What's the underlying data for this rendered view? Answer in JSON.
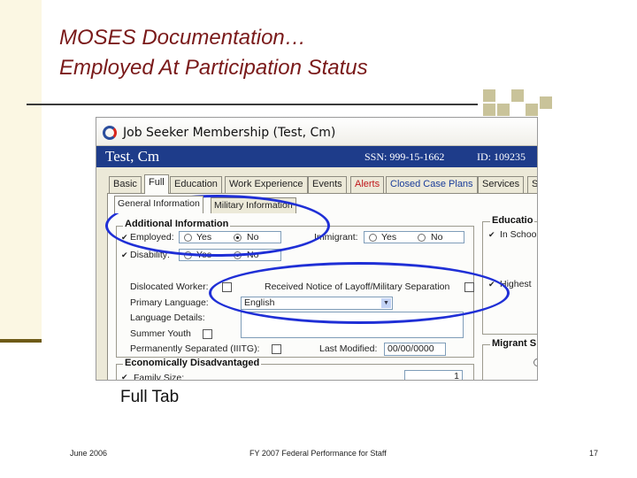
{
  "slide": {
    "title_line1": "MOSES Documentation…",
    "title_line2": "Employed At Participation Status",
    "caption": "Full Tab",
    "footer_date": "June 2006",
    "footer_center": "FY 2007 Federal Performance for Staff",
    "page_number": "17"
  },
  "window": {
    "title": "Job Seeker Membership (Test, Cm)",
    "icon": "moses-app-icon",
    "name": "Test, Cm",
    "ssn": "SSN:  999-15-1662",
    "id": "ID: 109235"
  },
  "tabs": [
    {
      "label": "Basic"
    },
    {
      "label": "Full"
    },
    {
      "label": "Education"
    },
    {
      "label": "Work Experience"
    },
    {
      "label": "Events"
    },
    {
      "label": "Alerts"
    },
    {
      "label": "Closed Case Plans"
    },
    {
      "label": "Services"
    },
    {
      "label": "S"
    }
  ],
  "subtabs": [
    {
      "label": "General Information"
    },
    {
      "label": "Military Information"
    }
  ],
  "additional_info": {
    "title": "Additional Information",
    "employed_label": "Employed:",
    "disability_label": "Disability:",
    "immigrant_label": "Immigrant:",
    "yes": "Yes",
    "no": "No",
    "dislocated_label": "Dislocated Worker:",
    "layoff_label": "Received Notice of Layoff/Military Separation",
    "primary_language_label": "Primary Language:",
    "primary_language_value": "English",
    "language_details_label": "Language Details:",
    "summer_youth_label": "Summer Youth",
    "perm_separated_label": "Permanently Separated (IIITG):",
    "last_modified_label": "Last Modified:",
    "last_modified_value": "00/00/0000"
  },
  "education": {
    "title": "Educatio",
    "in_school": "In Schoo",
    "highest": "Highest"
  },
  "migrant": {
    "title": "Migrant S"
  },
  "econ": {
    "title": "Economically Disadvantaged",
    "family_size_label": "Family Size:",
    "family_size_value": "1"
  }
}
